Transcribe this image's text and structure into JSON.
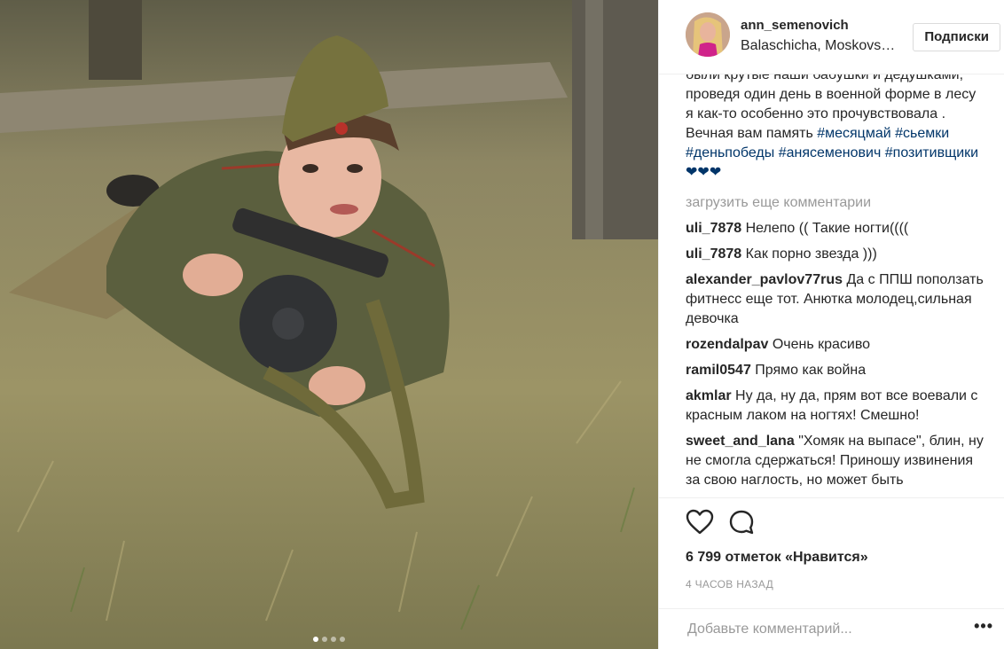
{
  "header": {
    "username": "ann_semenovich",
    "location": "Balaschicha, Moskovskaya Oblast'",
    "follow_label": "Подписки"
  },
  "caption": {
    "text": "были крутые наши бабушки и дедушками, проведя один день в военной форме в лесу я как-то особенно это прочувствовала . Вечная вам память ",
    "hashtags": [
      "#месяцмай",
      "#сьемки",
      "#деньпобеды",
      "#анясеменович",
      "#позитивщики"
    ],
    "emoji_tail": "❤❤❤"
  },
  "load_more_label": "загрузить еще комментарии",
  "comments": [
    {
      "user": "uli_7878",
      "text": "Нелепо (( Такие ногти(((("
    },
    {
      "user": "uli_7878",
      "text": "Как порно звезда )))"
    },
    {
      "user": "alexander_pavlov77rus",
      "text": "Да с ППШ поползать фитнесс еще тот. Анютка молодец,сильная девочка"
    },
    {
      "user": "rozendalpav",
      "text": "Очень красиво"
    },
    {
      "user": "ramil0547",
      "text": "Прямо как война"
    },
    {
      "user": "akmlar",
      "text": "Ну да, ну да, прям вот все воевали с красным лаком на ногтях! Смешно!"
    },
    {
      "user": "sweet_and_lana",
      "text": "\"Хомяк на выпасе\", блин, ну не смогла сдержаться! Приношу извинения за свою наглость, но может быть"
    }
  ],
  "icons": {
    "like": "heart-icon",
    "comment": "comment-bubble-icon",
    "more": "more-options-icon"
  },
  "likes_label": "6 799 отметок «Нравится»",
  "time_label": "4 часов назад",
  "add_comment": {
    "placeholder": "Добавьте комментарий...",
    "more_label": "•••"
  },
  "carousel": {
    "count": 4,
    "active": 1
  },
  "colors": {
    "link": "#003569",
    "muted": "#999999",
    "text": "#262626",
    "border": "#efefef"
  }
}
